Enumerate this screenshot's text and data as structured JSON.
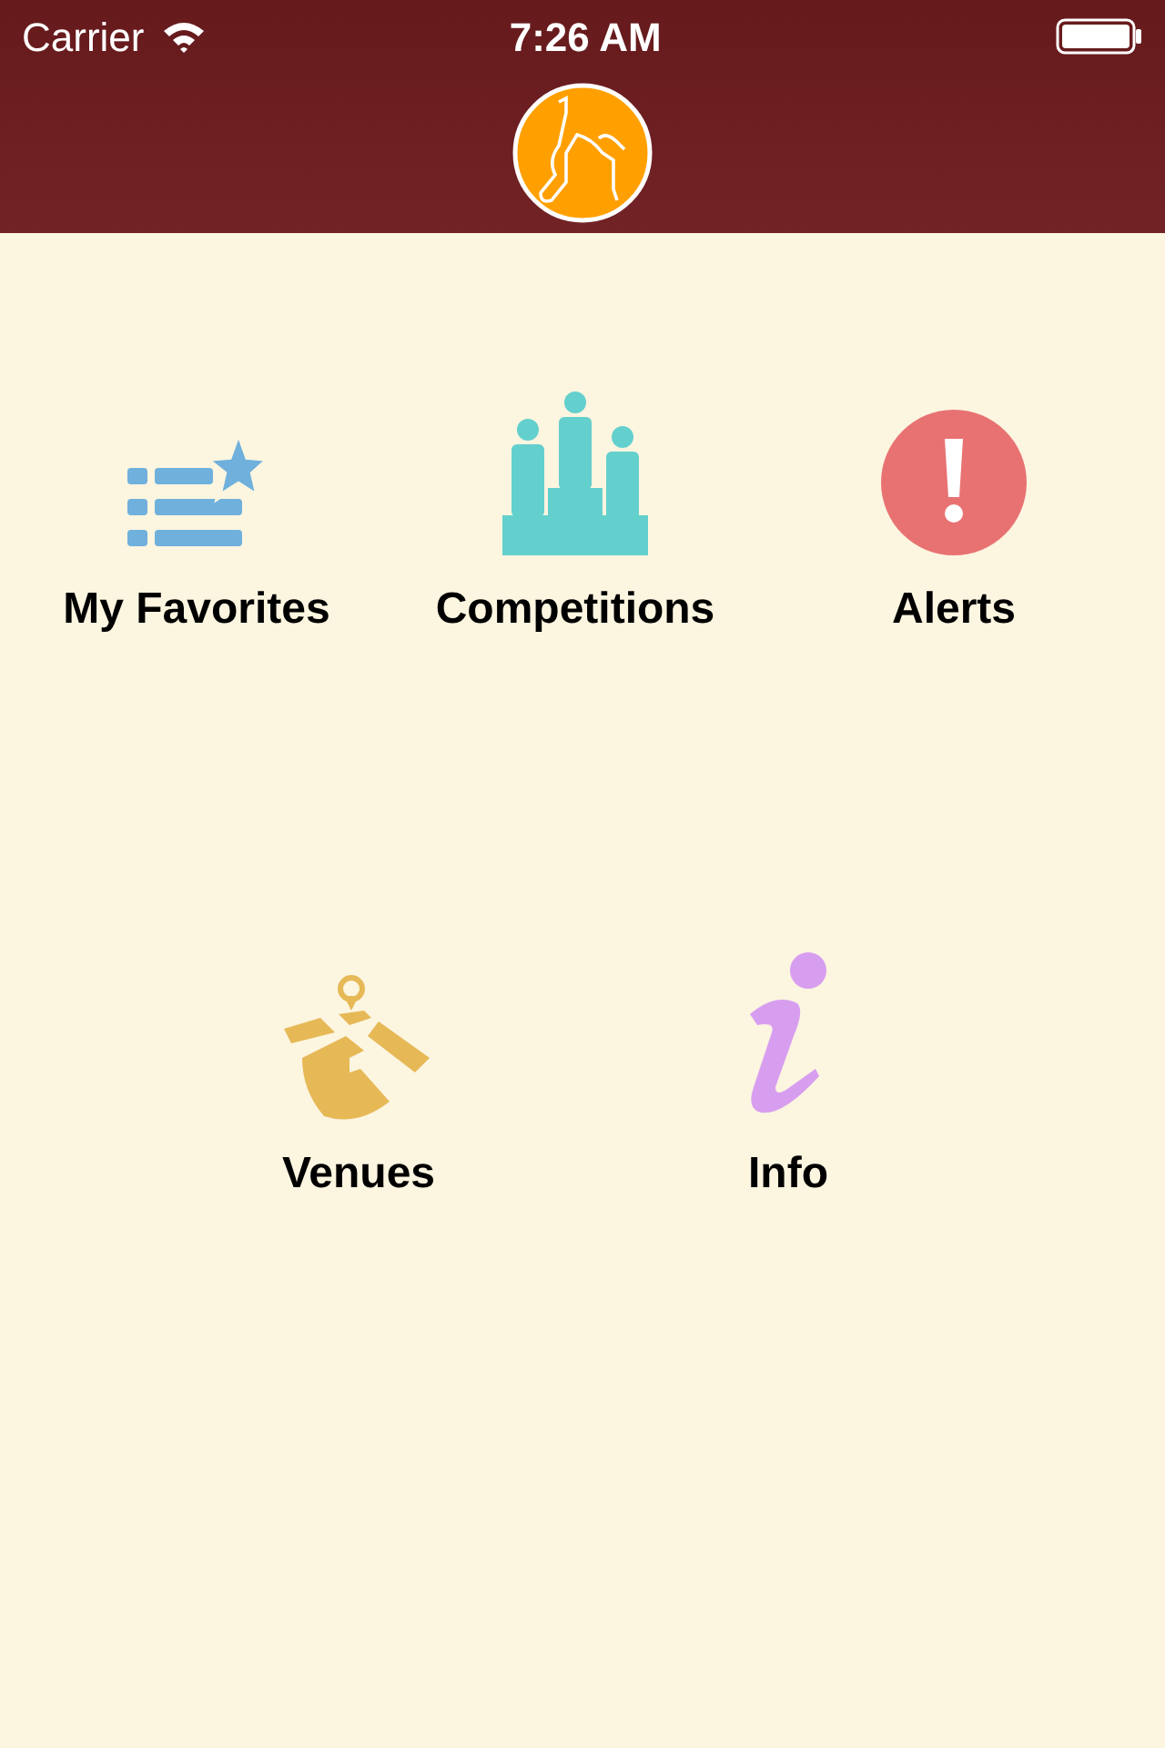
{
  "status_bar": {
    "carrier": "Carrier",
    "time": "7:26 AM"
  },
  "menu_rows": [
    [
      {
        "kind": "favorites",
        "label": "My Favorites"
      },
      {
        "kind": "competitions",
        "label": "Competitions"
      },
      {
        "kind": "alerts",
        "label": "Alerts"
      }
    ],
    [
      {
        "kind": "venues",
        "label": "Venues"
      },
      {
        "kind": "info",
        "label": "Info"
      }
    ]
  ]
}
